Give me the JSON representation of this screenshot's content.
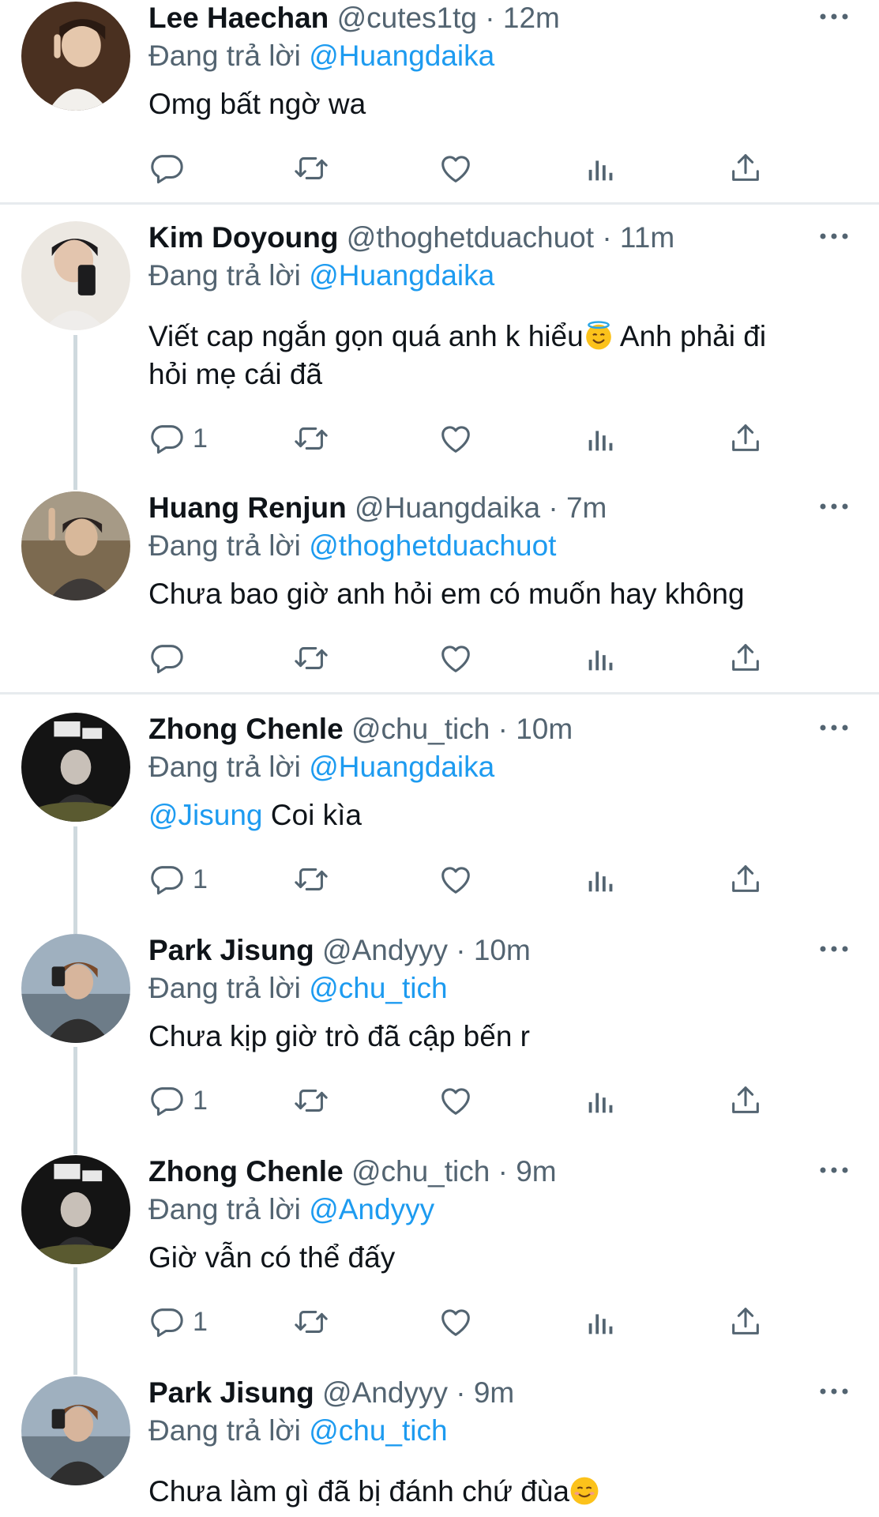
{
  "reply_prefix": "Đang trả lời",
  "tweets": [
    {
      "name": "Lee Haechan",
      "handle": "@cutes1tg",
      "time": "12m",
      "reply_to": "@Huangdaika",
      "text": "Omg bất ngờ wa",
      "reply_count": ""
    },
    {
      "name": "Kim Doyoung",
      "handle": "@thoghetduachuot",
      "time": "11m",
      "reply_to": "@Huangdaika",
      "text": "Viết cap ngắn gọn quá anh k hiểu",
      "text_after": " Anh phải đi",
      "text2": "hỏi mẹ cái đã",
      "reply_count": "1"
    },
    {
      "name": "Huang Renjun",
      "handle": "@Huangdaika",
      "time": "7m",
      "reply_to": "@thoghetduachuot",
      "text": "Chưa bao giờ anh hỏi em có muốn hay không",
      "reply_count": ""
    },
    {
      "name": "Zhong Chenle",
      "handle": "@chu_tich",
      "time": "10m",
      "reply_to": "@Huangdaika",
      "mention": "@Jisung",
      "text": " Coi kìa",
      "reply_count": "1"
    },
    {
      "name": "Park Jisung",
      "handle": "@Andyyy",
      "time": "10m",
      "reply_to": "@chu_tich",
      "text": "Chưa kịp giờ trò đã cập bến r",
      "reply_count": "1"
    },
    {
      "name": "Zhong Chenle",
      "handle": "@chu_tich",
      "time": "9m",
      "reply_to": "@Andyyy",
      "text": "Giờ vẫn có thể đấy",
      "reply_count": "1"
    },
    {
      "name": "Park Jisung",
      "handle": "@Andyyy",
      "time": "9m",
      "reply_to": "@chu_tich",
      "text": "Chưa làm gì đã bị đánh chứ đùa",
      "reply_count": ""
    }
  ],
  "icons": [
    "reply-icon",
    "retweet-icon",
    "like-icon",
    "views-icon",
    "share-icon",
    "more-icon",
    "halo-emoji",
    "smile-emoji"
  ],
  "colors": {
    "accent": "#1d9bf0",
    "secondary": "#536471",
    "text": "#0f1419",
    "separator": "#e7ebee",
    "thread": "#cfd9de"
  }
}
